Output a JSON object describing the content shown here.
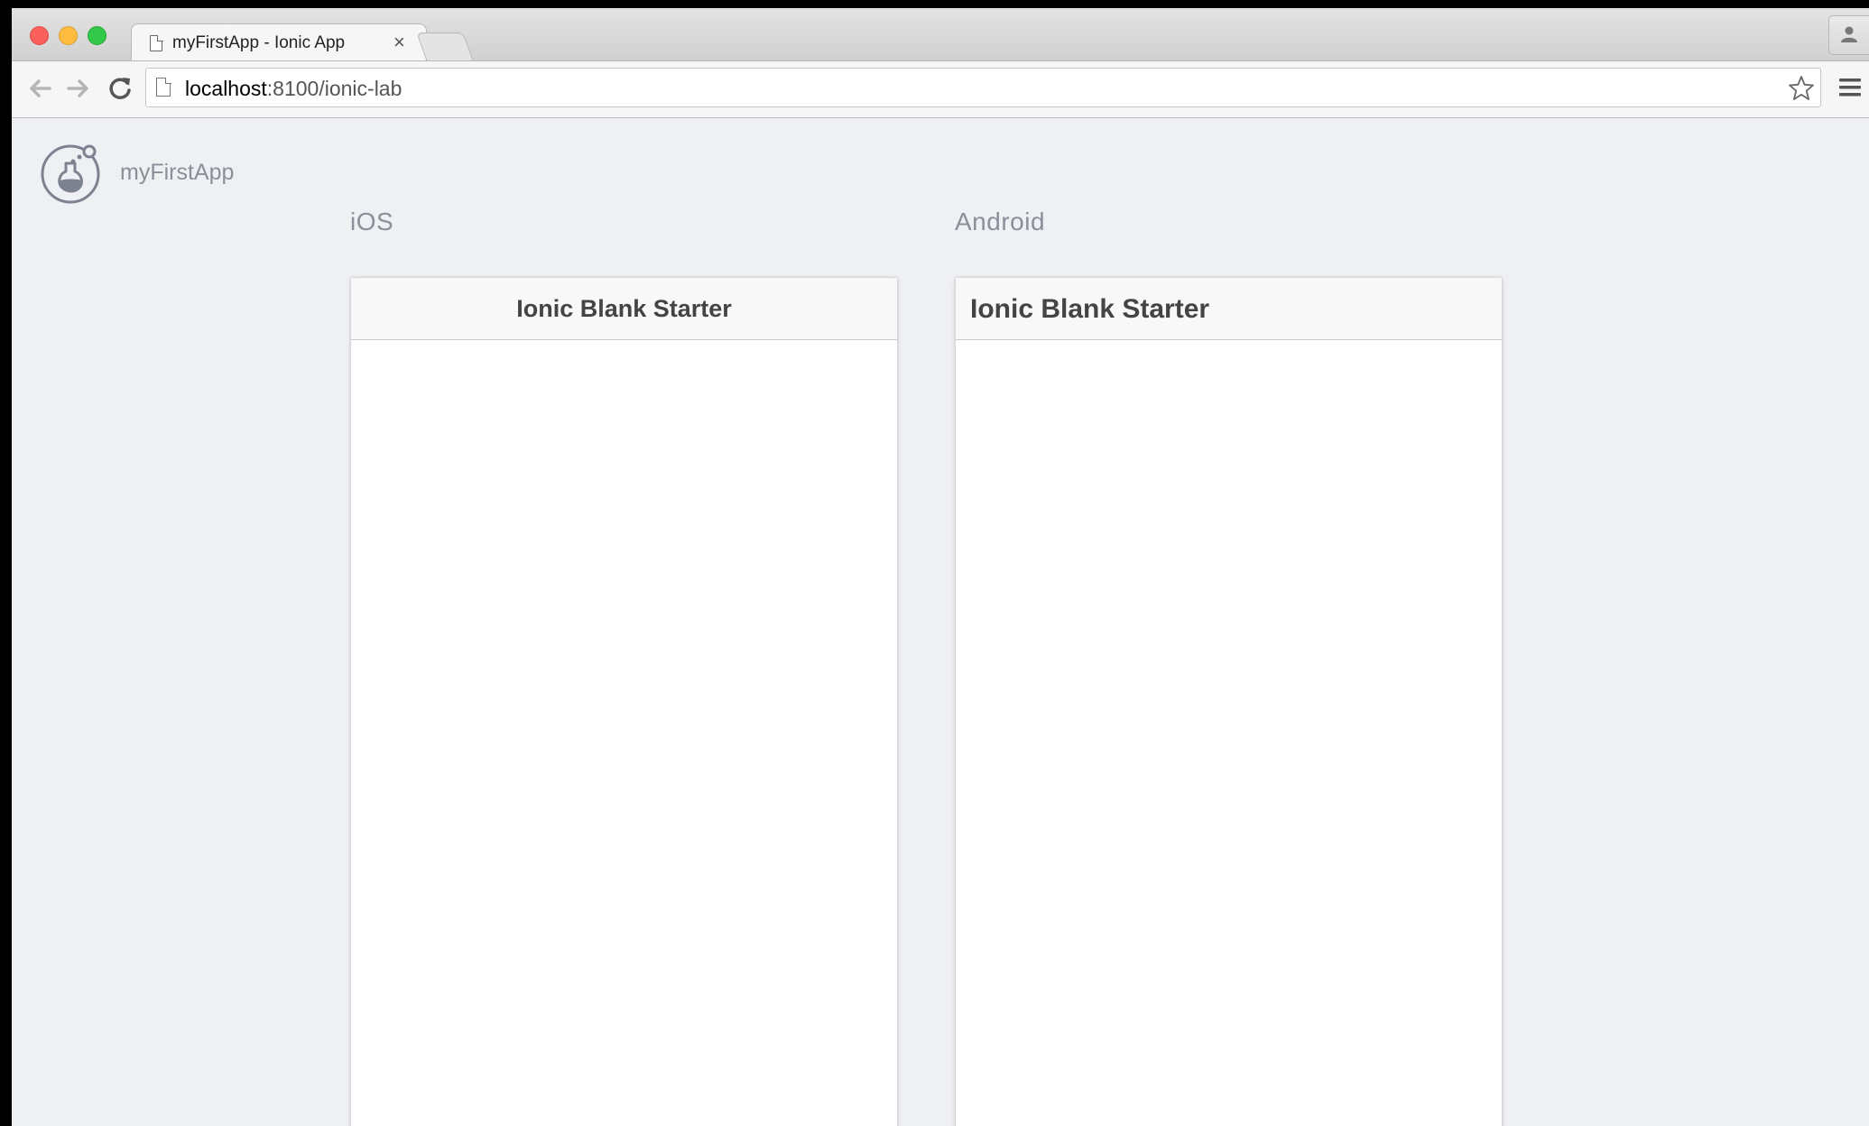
{
  "browser": {
    "tab_title": "myFirstApp - Ionic App",
    "tab_close": "×",
    "url_host": "localhost",
    "url_path": ":8100/ionic-lab"
  },
  "app": {
    "name": "myFirstApp",
    "logo_icon": "ionic-lab-flask-icon"
  },
  "platforms": {
    "ios": {
      "label": "iOS",
      "header_title": "Ionic Blank Starter"
    },
    "android": {
      "label": "Android",
      "header_title": "Ionic Blank Starter"
    }
  },
  "colors": {
    "page_background": "#eff0f3",
    "label_gray": "#8a8f99",
    "header_text": "#444444"
  }
}
